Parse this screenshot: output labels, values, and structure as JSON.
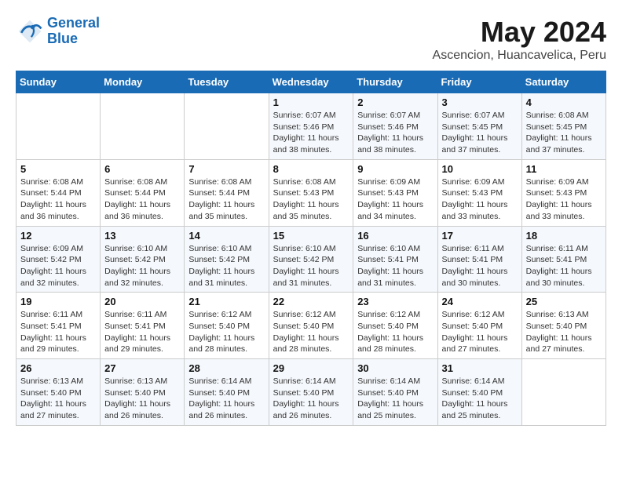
{
  "logo": {
    "line1": "General",
    "line2": "Blue"
  },
  "title": "May 2024",
  "location": "Ascencion, Huancavelica, Peru",
  "days_of_week": [
    "Sunday",
    "Monday",
    "Tuesday",
    "Wednesday",
    "Thursday",
    "Friday",
    "Saturday"
  ],
  "weeks": [
    [
      {
        "day": "",
        "info": ""
      },
      {
        "day": "",
        "info": ""
      },
      {
        "day": "",
        "info": ""
      },
      {
        "day": "1",
        "info": "Sunrise: 6:07 AM\nSunset: 5:46 PM\nDaylight: 11 hours\nand 38 minutes."
      },
      {
        "day": "2",
        "info": "Sunrise: 6:07 AM\nSunset: 5:46 PM\nDaylight: 11 hours\nand 38 minutes."
      },
      {
        "day": "3",
        "info": "Sunrise: 6:07 AM\nSunset: 5:45 PM\nDaylight: 11 hours\nand 37 minutes."
      },
      {
        "day": "4",
        "info": "Sunrise: 6:08 AM\nSunset: 5:45 PM\nDaylight: 11 hours\nand 37 minutes."
      }
    ],
    [
      {
        "day": "5",
        "info": "Sunrise: 6:08 AM\nSunset: 5:44 PM\nDaylight: 11 hours\nand 36 minutes."
      },
      {
        "day": "6",
        "info": "Sunrise: 6:08 AM\nSunset: 5:44 PM\nDaylight: 11 hours\nand 36 minutes."
      },
      {
        "day": "7",
        "info": "Sunrise: 6:08 AM\nSunset: 5:44 PM\nDaylight: 11 hours\nand 35 minutes."
      },
      {
        "day": "8",
        "info": "Sunrise: 6:08 AM\nSunset: 5:43 PM\nDaylight: 11 hours\nand 35 minutes."
      },
      {
        "day": "9",
        "info": "Sunrise: 6:09 AM\nSunset: 5:43 PM\nDaylight: 11 hours\nand 34 minutes."
      },
      {
        "day": "10",
        "info": "Sunrise: 6:09 AM\nSunset: 5:43 PM\nDaylight: 11 hours\nand 33 minutes."
      },
      {
        "day": "11",
        "info": "Sunrise: 6:09 AM\nSunset: 5:43 PM\nDaylight: 11 hours\nand 33 minutes."
      }
    ],
    [
      {
        "day": "12",
        "info": "Sunrise: 6:09 AM\nSunset: 5:42 PM\nDaylight: 11 hours\nand 32 minutes."
      },
      {
        "day": "13",
        "info": "Sunrise: 6:10 AM\nSunset: 5:42 PM\nDaylight: 11 hours\nand 32 minutes."
      },
      {
        "day": "14",
        "info": "Sunrise: 6:10 AM\nSunset: 5:42 PM\nDaylight: 11 hours\nand 31 minutes."
      },
      {
        "day": "15",
        "info": "Sunrise: 6:10 AM\nSunset: 5:42 PM\nDaylight: 11 hours\nand 31 minutes."
      },
      {
        "day": "16",
        "info": "Sunrise: 6:10 AM\nSunset: 5:41 PM\nDaylight: 11 hours\nand 31 minutes."
      },
      {
        "day": "17",
        "info": "Sunrise: 6:11 AM\nSunset: 5:41 PM\nDaylight: 11 hours\nand 30 minutes."
      },
      {
        "day": "18",
        "info": "Sunrise: 6:11 AM\nSunset: 5:41 PM\nDaylight: 11 hours\nand 30 minutes."
      }
    ],
    [
      {
        "day": "19",
        "info": "Sunrise: 6:11 AM\nSunset: 5:41 PM\nDaylight: 11 hours\nand 29 minutes."
      },
      {
        "day": "20",
        "info": "Sunrise: 6:11 AM\nSunset: 5:41 PM\nDaylight: 11 hours\nand 29 minutes."
      },
      {
        "day": "21",
        "info": "Sunrise: 6:12 AM\nSunset: 5:40 PM\nDaylight: 11 hours\nand 28 minutes."
      },
      {
        "day": "22",
        "info": "Sunrise: 6:12 AM\nSunset: 5:40 PM\nDaylight: 11 hours\nand 28 minutes."
      },
      {
        "day": "23",
        "info": "Sunrise: 6:12 AM\nSunset: 5:40 PM\nDaylight: 11 hours\nand 28 minutes."
      },
      {
        "day": "24",
        "info": "Sunrise: 6:12 AM\nSunset: 5:40 PM\nDaylight: 11 hours\nand 27 minutes."
      },
      {
        "day": "25",
        "info": "Sunrise: 6:13 AM\nSunset: 5:40 PM\nDaylight: 11 hours\nand 27 minutes."
      }
    ],
    [
      {
        "day": "26",
        "info": "Sunrise: 6:13 AM\nSunset: 5:40 PM\nDaylight: 11 hours\nand 27 minutes."
      },
      {
        "day": "27",
        "info": "Sunrise: 6:13 AM\nSunset: 5:40 PM\nDaylight: 11 hours\nand 26 minutes."
      },
      {
        "day": "28",
        "info": "Sunrise: 6:14 AM\nSunset: 5:40 PM\nDaylight: 11 hours\nand 26 minutes."
      },
      {
        "day": "29",
        "info": "Sunrise: 6:14 AM\nSunset: 5:40 PM\nDaylight: 11 hours\nand 26 minutes."
      },
      {
        "day": "30",
        "info": "Sunrise: 6:14 AM\nSunset: 5:40 PM\nDaylight: 11 hours\nand 25 minutes."
      },
      {
        "day": "31",
        "info": "Sunrise: 6:14 AM\nSunset: 5:40 PM\nDaylight: 11 hours\nand 25 minutes."
      },
      {
        "day": "",
        "info": ""
      }
    ]
  ]
}
